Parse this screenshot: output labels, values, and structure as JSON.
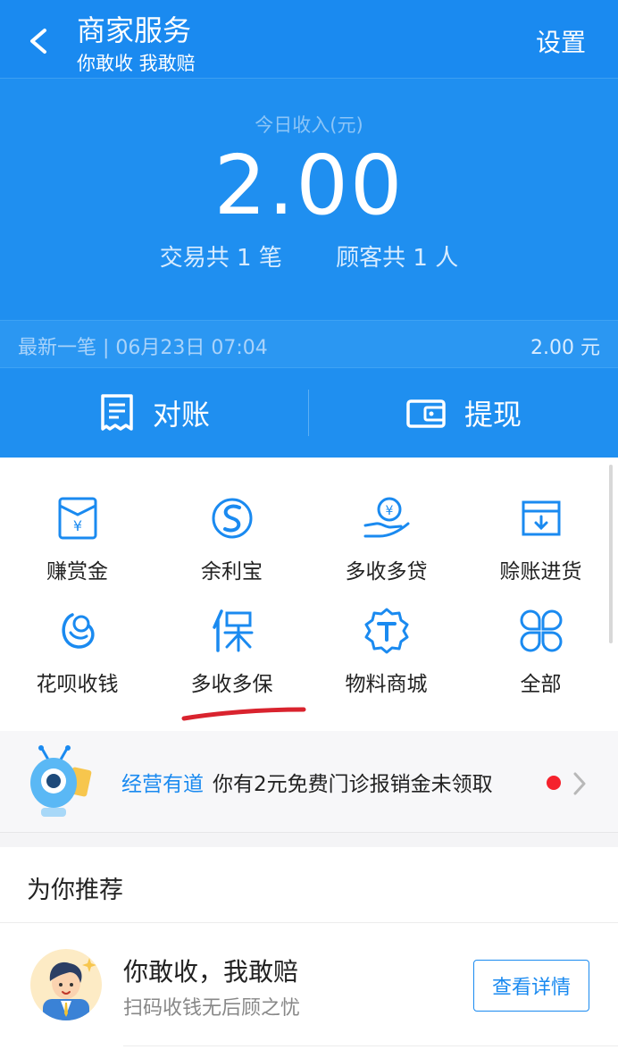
{
  "topbar": {
    "title": "商家服务",
    "subtitle": "你敢收 我敢赔",
    "settings": "设置"
  },
  "summary": {
    "income_label": "今日收入(元)",
    "income_value": "2.00",
    "transactions": "交易共 1 笔",
    "customers": "顾客共 1 人"
  },
  "latest": {
    "left": "最新一笔 | 06月23日 07:04",
    "right": "2.00 元"
  },
  "actions": {
    "reconcile": "对账",
    "withdraw": "提现"
  },
  "grid": [
    {
      "label": "赚赏金",
      "icon": "reward-envelope-icon"
    },
    {
      "label": "余利宝",
      "icon": "yulibao-icon"
    },
    {
      "label": "多收多贷",
      "icon": "loan-hand-icon"
    },
    {
      "label": "赊账进货",
      "icon": "purchase-box-icon"
    },
    {
      "label": "花呗收钱",
      "icon": "huabei-icon"
    },
    {
      "label": "多收多保",
      "icon": "insurance-icon"
    },
    {
      "label": "物料商城",
      "icon": "materials-store-icon"
    },
    {
      "label": "全部",
      "icon": "all-apps-icon"
    }
  ],
  "banner": {
    "tag": "经营有道",
    "text": "你有2元免费门诊报销金未领取"
  },
  "recommend": {
    "title": "为你推荐",
    "item_title": "你敢收，我敢赔",
    "item_sub": "扫码收钱无后顾之忧",
    "button": "查看详情"
  },
  "colors": {
    "brand_blue": "#1a8af0",
    "alert_red": "#f5222d",
    "annotation_red": "#d9232e"
  }
}
